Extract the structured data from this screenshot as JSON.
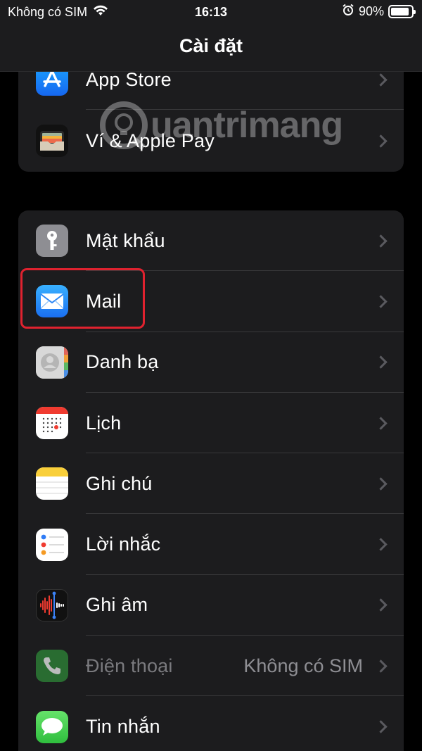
{
  "status_bar": {
    "carrier": "Không có SIM",
    "time": "16:13",
    "battery_percent": "90%",
    "battery_level": 0.9,
    "wifi_icon": "wifi-icon",
    "alarm_icon": "alarm-icon"
  },
  "nav": {
    "title": "Cài đặt"
  },
  "watermark": {
    "text": "uantrimang"
  },
  "group_top": {
    "items": [
      {
        "label": "App Store",
        "icon": "app-store-icon"
      },
      {
        "label": "Ví & Apple Pay",
        "icon": "wallet-icon"
      }
    ]
  },
  "group_main": {
    "items": [
      {
        "label": "Mật khẩu",
        "icon": "key-icon"
      },
      {
        "label": "Mail",
        "icon": "mail-icon",
        "highlighted": true
      },
      {
        "label": "Danh bạ",
        "icon": "contacts-icon"
      },
      {
        "label": "Lịch",
        "icon": "calendar-icon"
      },
      {
        "label": "Ghi chú",
        "icon": "notes-icon"
      },
      {
        "label": "Lời nhắc",
        "icon": "reminders-icon"
      },
      {
        "label": "Ghi âm",
        "icon": "voice-memos-icon"
      },
      {
        "label": "Điện thoại",
        "icon": "phone-icon",
        "value": "Không có SIM",
        "disabled": true
      },
      {
        "label": "Tin nhắn",
        "icon": "messages-icon"
      }
    ]
  },
  "colors": {
    "background": "#000000",
    "cell": "#1c1c1e",
    "highlight": "#e0222f",
    "chevron": "#5a5a5f"
  }
}
